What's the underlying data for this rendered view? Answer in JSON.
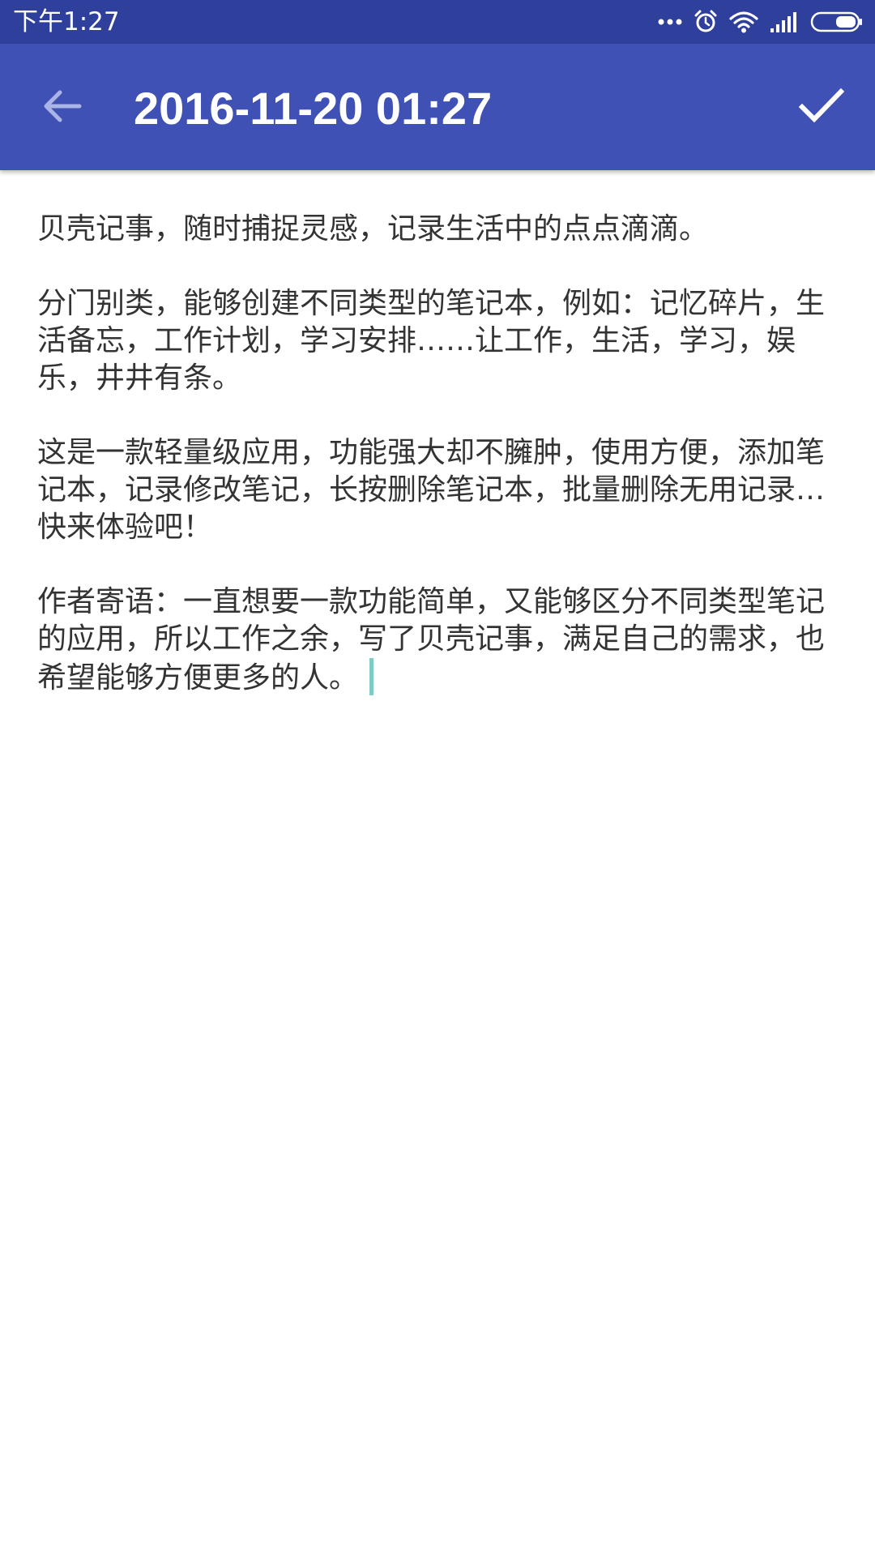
{
  "status_bar": {
    "time": "下午1:27",
    "icons": [
      "more-dots-icon",
      "alarm-icon",
      "wifi-icon",
      "signal-icon",
      "battery-icon"
    ]
  },
  "app_bar": {
    "title": "2016-11-20 01:27",
    "back_icon": "arrow-back-icon",
    "confirm_icon": "check-icon",
    "color": "#3f51b5"
  },
  "note": {
    "paragraphs": [
      "贝壳记事，随时捕捉灵感，记录生活中的点点滴滴。",
      "分门别类，能够创建不同类型的笔记本，例如：记忆碎片，生活备忘，工作计划，学习安排……让工作，生活，学习，娱乐，井井有条。",
      "这是一款轻量级应用，功能强大却不臃肿，使用方便，添加笔记本，记录修改笔记，长按删除笔记本，批量删除无用记录…快来体验吧！",
      "作者寄语：一直想要一款功能简单，又能够区分不同类型笔记的应用，所以工作之余，写了贝壳记事，满足自己的需求，也希望能够方便更多的人。"
    ],
    "cursor_color": "#80cbc4"
  }
}
